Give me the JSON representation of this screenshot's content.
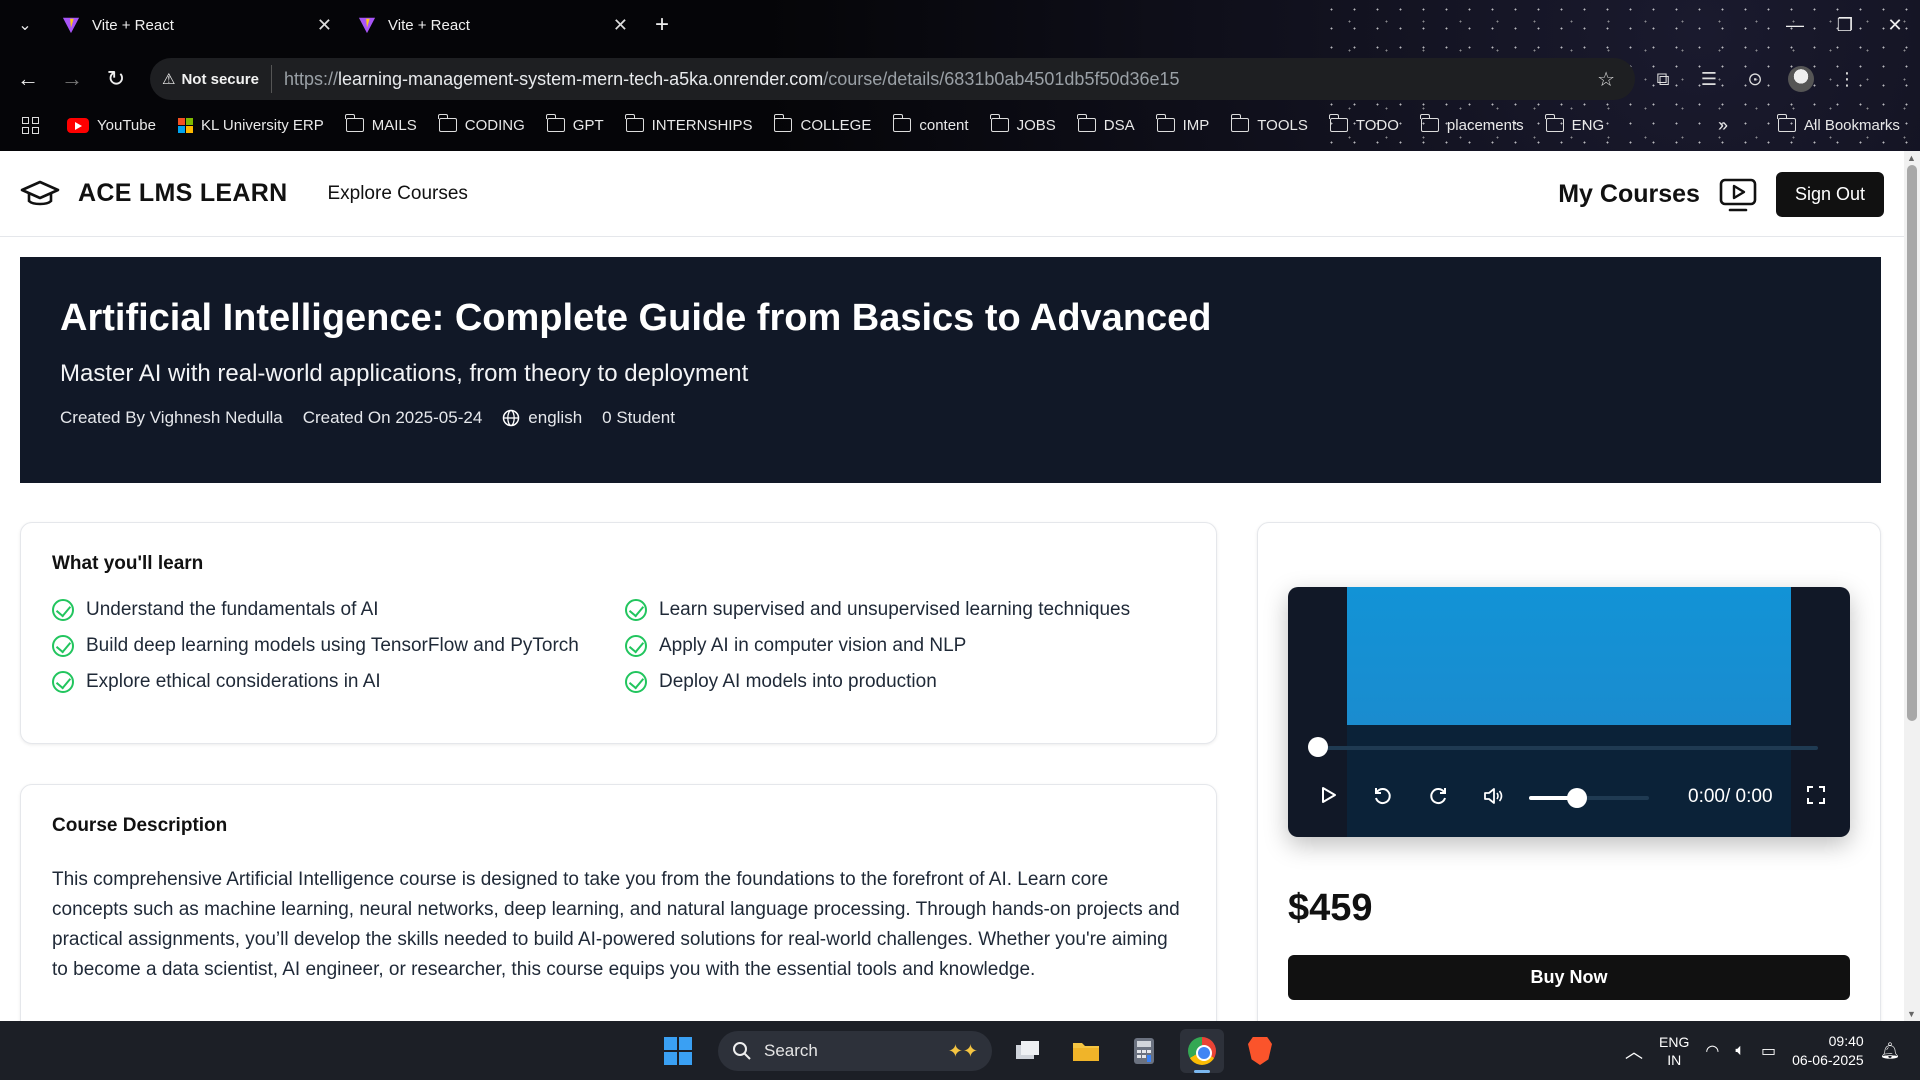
{
  "browser": {
    "tabs": [
      {
        "title": "Vite + React",
        "active": false
      },
      {
        "title": "Vite + React",
        "active": true
      }
    ],
    "security_label": "Not secure",
    "url_scheme": "https://",
    "url_host": "learning-management-system-mern-tech-a5ka.onrender.com",
    "url_path": "/course/details/6831b0ab4501db5f50d36e15",
    "bookmarks": [
      "YouTube",
      "KL University ERP",
      "MAILS",
      "CODING",
      "GPT",
      "INTERNSHIPS",
      "COLLEGE",
      "content",
      "JOBS",
      "DSA",
      "IMP",
      "TOOLS",
      "TODO",
      "placements",
      "ENG"
    ],
    "all_bookmarks_label": "All Bookmarks"
  },
  "site": {
    "brand": "ACE LMS LEARN",
    "nav_explore": "Explore Courses",
    "my_courses": "My Courses",
    "sign_out": "Sign Out"
  },
  "course": {
    "title": "Artificial Intelligence: Complete Guide from Basics to Advanced",
    "subtitle": "Master AI with real-world applications, from theory to deployment",
    "created_by": "Created By Vighnesh Nedulla",
    "created_on": "Created On 2025-05-24",
    "language": "english",
    "students": "0 Student",
    "learn_title": "What you'll learn",
    "learn_items": [
      "Understand the fundamentals of AI",
      "Learn supervised and unsupervised learning techniques",
      "Build deep learning models using TensorFlow and PyTorch",
      "Apply AI in computer vision and NLP",
      "Explore ethical considerations in AI",
      "Deploy AI models into production"
    ],
    "description_title": "Course Description",
    "description": "This comprehensive Artificial Intelligence course is designed to take you from the foundations to the forefront of AI. Learn core concepts such as machine learning, neural networks, deep learning, and natural language processing. Through hands-on projects and practical assignments, you’ll develop the skills needed to build AI-powered solutions for real-world challenges. Whether you're aiming to become a data scientist, AI engineer, or researcher, this course equips you with the essential tools and knowledge.",
    "price": "$459",
    "buy_label": "Buy Now"
  },
  "player": {
    "time": "0:00/ 0:00",
    "volume_fraction": 0.4,
    "progress_fraction": 0
  },
  "taskbar": {
    "search_placeholder": "Search",
    "lang_top": "ENG",
    "lang_bottom": "IN",
    "time": "09:40",
    "date": "06-06-2025"
  },
  "colors": {
    "hero_bg": "#111827",
    "check_green": "#22c55e",
    "video_blue": "#1293d6",
    "button_black": "#111111"
  }
}
